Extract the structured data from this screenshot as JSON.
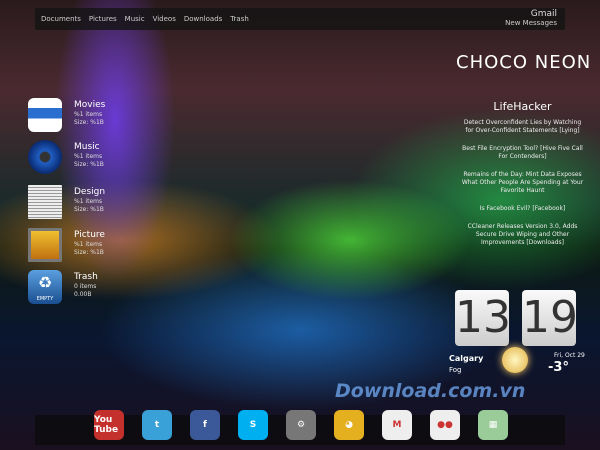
{
  "topbar": {
    "items": [
      "Documents",
      "Pictures",
      "Music",
      "Videos",
      "Downloads",
      "Trash"
    ],
    "gmail_title": "Gmail",
    "gmail_sub": "New Messages"
  },
  "stacks": [
    {
      "name": "Movies",
      "items": "%1 items",
      "size": "Size: %1B",
      "icon": "3d-glasses-icon",
      "color": "#2a6fd0"
    },
    {
      "name": "Music",
      "items": "%1 items",
      "size": "Size: %1B",
      "icon": "speaker-icon",
      "color": "#1f5fc4"
    },
    {
      "name": "Design",
      "items": "%1 items",
      "size": "Size: %1B",
      "icon": "newspaper-icon",
      "color": "#ddd"
    },
    {
      "name": "Picture",
      "items": "%1 items",
      "size": "Size: %1B",
      "icon": "picture-icon",
      "color": "#e0a020"
    },
    {
      "name": "Trash",
      "items": "0 items",
      "size": "0.00B",
      "icon": "recycle-icon",
      "color": "#3a7fd0",
      "button": "EMPTY"
    }
  ],
  "brand": "CHOCO NEON",
  "feed": {
    "title": "LifeHacker",
    "items": [
      "Detect Overconfident Lies by Watching for Over-Confident Statements [Lying]",
      "Best File Encryption Tool? [Hive Five Call For Contenders]",
      "Remains of the Day: Mint Data Exposes What Other People Are Spending at Your Favorite Haunt",
      "Is Facebook Evil? [Facebook]",
      "CCleaner Releases Version 3.0, Adds Secure Drive Wiping and Other Improvements [Downloads]"
    ]
  },
  "clock": {
    "hour": "13",
    "minute": "19",
    "city": "Calgary",
    "condition": "Fog",
    "date": "Fri, Oct 29",
    "temp": "-3°"
  },
  "watermark": "Download.com.vn",
  "dock": [
    {
      "label": "You Tube",
      "icon": "youtube-icon",
      "color": "#c4302b"
    },
    {
      "label": "t",
      "icon": "twitter-icon",
      "color": "#3aa0d8"
    },
    {
      "label": "f",
      "icon": "facebook-icon",
      "color": "#3b5998"
    },
    {
      "label": "S",
      "icon": "skype-icon",
      "color": "#00aff0"
    },
    {
      "label": "⚙",
      "icon": "utility-icon",
      "color": "#777"
    },
    {
      "label": "◕",
      "icon": "chrome-icon",
      "color": "#e5b020"
    },
    {
      "label": "M",
      "icon": "gmail-icon",
      "color": "#eee"
    },
    {
      "label": "●●",
      "icon": "flickr-icon",
      "color": "#eee"
    },
    {
      "label": "▦",
      "icon": "maps-icon",
      "color": "#9c9"
    }
  ]
}
